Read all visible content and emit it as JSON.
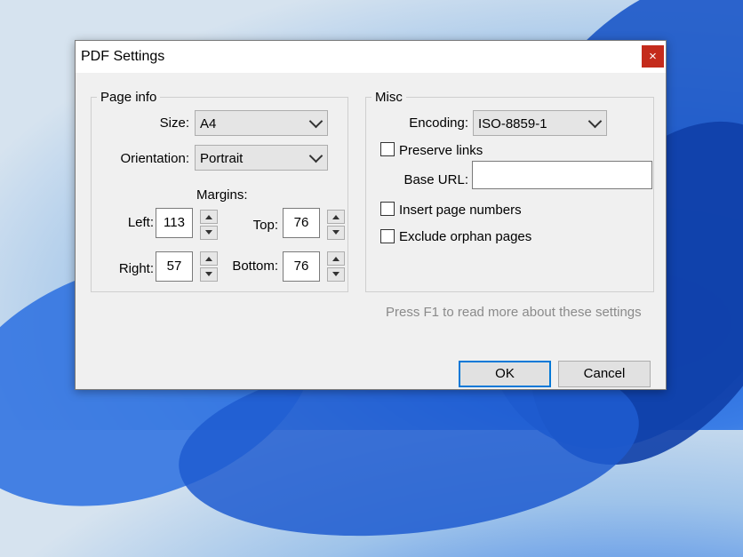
{
  "window": {
    "title": "PDF Settings",
    "close_label": "×"
  },
  "page_info": {
    "legend": "Page info",
    "size_label": "Size:",
    "size_value": "A4",
    "orientation_label": "Orientation:",
    "orientation_value": "Portrait",
    "margins_label": "Margins:",
    "left_label": "Left:",
    "left_value": "113",
    "top_label": "Top:",
    "top_value": "76",
    "right_label": "Right:",
    "right_value": "57",
    "bottom_label": "Bottom:",
    "bottom_value": "76"
  },
  "misc": {
    "legend": "Misc",
    "encoding_label": "Encoding:",
    "encoding_value": "ISO-8859-1",
    "preserve_links_label": "Preserve links",
    "preserve_links_checked": false,
    "base_url_label": "Base URL:",
    "base_url_value": "",
    "insert_page_numbers_label": "Insert page numbers",
    "insert_page_numbers_checked": false,
    "exclude_orphan_pages_label": "Exclude orphan pages",
    "exclude_orphan_pages_checked": false
  },
  "hint_text": "Press F1 to read more about these settings",
  "buttons": {
    "ok_label": "OK",
    "cancel_label": "Cancel"
  },
  "colors": {
    "close_button": "#c42b1c",
    "default_button_border": "#0078d7",
    "hint_text": "#8a8a8a"
  }
}
